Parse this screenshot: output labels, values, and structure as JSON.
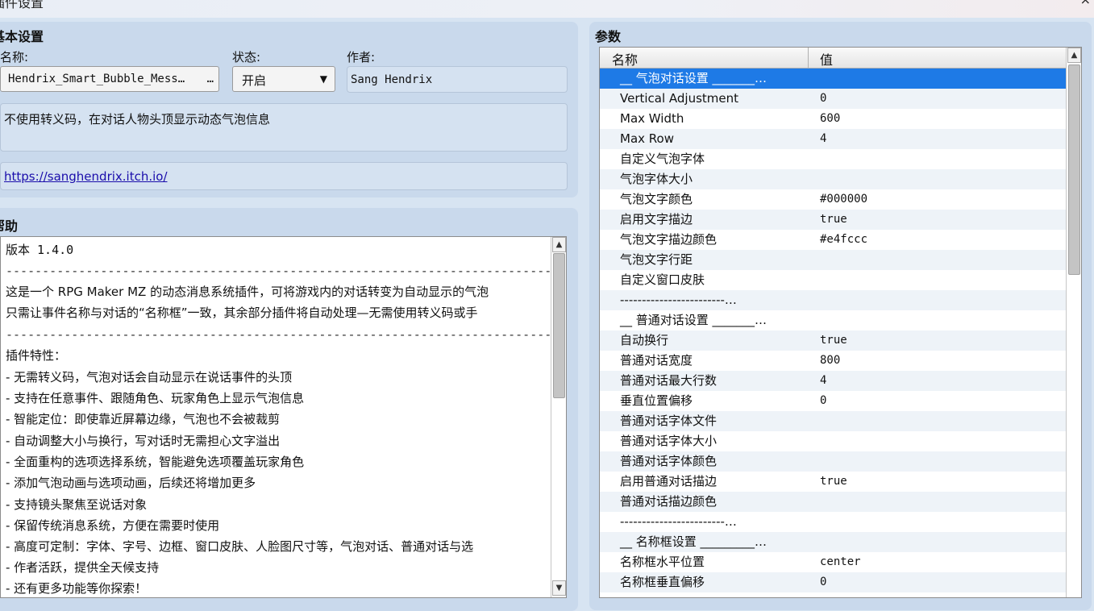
{
  "window": {
    "title": "插件设置",
    "close_glyph": "×"
  },
  "basic": {
    "section_title": "基本设置",
    "name_label": "名称:",
    "name_value": "Hendrix_Smart_Bubble_Mess…",
    "name_button": "…",
    "status_label": "状态:",
    "status_value": "开启",
    "author_label": "作者:",
    "author_value": "Sang Hendrix",
    "description": "不使用转义码，在对话人物头顶显示动态气泡信息",
    "url": "https://sanghendrix.itch.io/"
  },
  "help": {
    "section_title": "帮助",
    "lines": [
      "版本 1.4.0",
      "------------------------------------------------------------------------------------------------------------------------------",
      "这是一个 RPG Maker MZ 的动态消息系统插件，可将游戏内的对话转变为自动显示的气泡",
      "只需让事件名称与对话的“名称框”一致，其余部分插件将自动处理—无需使用转义码或手",
      "------------------------------------------------------------------------------------------------------------------------------",
      "插件特性：",
      "- 无需转义码，气泡对话会自动显示在说话事件的头顶",
      "- 支持在任意事件、跟随角色、玩家角色上显示气泡信息",
      "- 智能定位：即使靠近屏幕边缘，气泡也不会被裁剪",
      "- 自动调整大小与换行，写对话时无需担心文字溢出",
      "- 全面重构的选项选择系统，智能避免选项覆盖玩家角色",
      "- 添加气泡动画与选项动画，后续还将增加更多",
      "- 支持镜头聚焦至说话对象",
      "- 保留传统消息系统，方便在需要时使用",
      "- 高度可定制：字体、字号、边框、窗口皮肤、人脸图尺寸等，气泡对话、普通对话与选",
      "- 作者活跃，提供全天候支持",
      "- 还有更多功能等你探索！"
    ]
  },
  "params": {
    "section_title": "参数",
    "col_name": "名称",
    "col_value": "值",
    "rows": [
      {
        "k": "__ 气泡对话设置 _______…",
        "v": ""
      },
      {
        "k": "Vertical Adjustment",
        "v": "0"
      },
      {
        "k": "Max Width",
        "v": "600"
      },
      {
        "k": "Max Row",
        "v": "4"
      },
      {
        "k": "自定义气泡字体",
        "v": ""
      },
      {
        "k": "气泡字体大小",
        "v": ""
      },
      {
        "k": "气泡文字颜色",
        "v": "#000000"
      },
      {
        "k": "启用文字描边",
        "v": "true"
      },
      {
        "k": "气泡文字描边颜色",
        "v": "#e4fccc"
      },
      {
        "k": "气泡文字行距",
        "v": ""
      },
      {
        "k": "自定义窗口皮肤",
        "v": ""
      },
      {
        "k": "------------------------…",
        "v": ""
      },
      {
        "k": "__ 普通对话设置 _______…",
        "v": ""
      },
      {
        "k": "自动换行",
        "v": "true"
      },
      {
        "k": "普通对话宽度",
        "v": "800"
      },
      {
        "k": "普通对话最大行数",
        "v": "4"
      },
      {
        "k": "垂直位置偏移",
        "v": "0"
      },
      {
        "k": "普通对话字体文件",
        "v": ""
      },
      {
        "k": "普通对话字体大小",
        "v": ""
      },
      {
        "k": "普通对话字体颜色",
        "v": ""
      },
      {
        "k": "启用普通对话描边",
        "v": "true"
      },
      {
        "k": "普通对话描边颜色",
        "v": ""
      },
      {
        "k": "------------------------…",
        "v": ""
      },
      {
        "k": "__ 名称框设置 _________…",
        "v": ""
      },
      {
        "k": "名称框水平位置",
        "v": "center"
      },
      {
        "k": "名称框垂直偏移",
        "v": "0"
      }
    ]
  },
  "colors": {
    "selection": "#1e7ae6",
    "link": "#1a0dab",
    "panel": "#c9d9ec"
  }
}
